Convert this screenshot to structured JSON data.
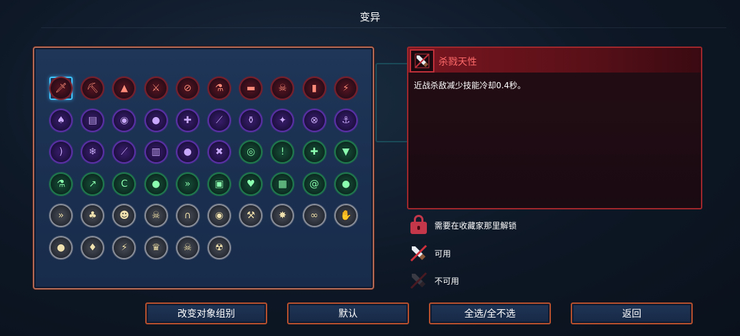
{
  "header": {
    "title": "变异"
  },
  "grid": {
    "icons": [
      {
        "icon": "sword-icon",
        "glyph": "🗡",
        "color": "red",
        "selected": true
      },
      {
        "icon": "pickaxe-icon",
        "glyph": "⛏",
        "color": "red"
      },
      {
        "icon": "spear-icon",
        "glyph": "▲",
        "color": "red"
      },
      {
        "icon": "ice-sword-icon",
        "glyph": "⚔",
        "color": "red"
      },
      {
        "icon": "no-entry-icon",
        "glyph": "⊘",
        "color": "red"
      },
      {
        "icon": "potion-icon",
        "glyph": "⚗",
        "color": "red"
      },
      {
        "icon": "chest-icon",
        "glyph": "▬",
        "color": "red"
      },
      {
        "icon": "skull-cross-icon",
        "glyph": "☠",
        "color": "red"
      },
      {
        "icon": "blue-vial-icon",
        "glyph": "▮",
        "color": "red"
      },
      {
        "icon": "lightning-fist-icon",
        "glyph": "⚡",
        "color": "red"
      },
      {
        "icon": "hat-icon",
        "glyph": "♠",
        "color": "purple"
      },
      {
        "icon": "book-blade-icon",
        "glyph": "▤",
        "color": "purple"
      },
      {
        "icon": "eye-icon",
        "glyph": "◉",
        "color": "purple"
      },
      {
        "icon": "bomb-icon",
        "glyph": "●",
        "color": "purple"
      },
      {
        "icon": "target-icon",
        "glyph": "✚",
        "color": "purple"
      },
      {
        "icon": "knife-icon",
        "glyph": "⟋",
        "color": "purple"
      },
      {
        "icon": "green-potion-icon",
        "glyph": "⚱",
        "color": "purple"
      },
      {
        "icon": "spike-icon",
        "glyph": "✦",
        "color": "purple"
      },
      {
        "icon": "no-cross-icon",
        "glyph": "⊗",
        "color": "purple"
      },
      {
        "icon": "hook-icon",
        "glyph": "⚓",
        "color": "purple"
      },
      {
        "icon": "bow-icon",
        "glyph": ")",
        "color": "purple"
      },
      {
        "icon": "frost-gun-icon",
        "glyph": "❄",
        "color": "purple"
      },
      {
        "icon": "staff-icon",
        "glyph": "⟋",
        "color": "purple"
      },
      {
        "icon": "tome-icon",
        "glyph": "▥",
        "color": "purple"
      },
      {
        "icon": "drop-icon",
        "glyph": "●",
        "color": "purple"
      },
      {
        "icon": "crossed-skull-icon",
        "glyph": "✖",
        "color": "purple"
      },
      {
        "icon": "gear-eye-icon",
        "glyph": "◎",
        "color": "green"
      },
      {
        "icon": "exclaim-shield-icon",
        "glyph": "!",
        "color": "green"
      },
      {
        "icon": "plus-shield-icon",
        "glyph": "✚",
        "color": "green"
      },
      {
        "icon": "fangs-icon",
        "glyph": "▼",
        "color": "green"
      },
      {
        "icon": "red-potion-icon",
        "glyph": "⚗",
        "color": "green"
      },
      {
        "icon": "arrow-icon",
        "glyph": "↗",
        "color": "green"
      },
      {
        "icon": "hook-claw-icon",
        "glyph": "C",
        "color": "green"
      },
      {
        "icon": "blood-drop-icon",
        "glyph": "●",
        "color": "green"
      },
      {
        "icon": "chevrons-icon",
        "glyph": "»",
        "color": "green"
      },
      {
        "icon": "knight-icon",
        "glyph": "▣",
        "color": "green"
      },
      {
        "icon": "heart-arm-icon",
        "glyph": "♥",
        "color": "green"
      },
      {
        "icon": "cage-icon",
        "glyph": "▦",
        "color": "green"
      },
      {
        "icon": "coil-icon",
        "glyph": "@",
        "color": "green"
      },
      {
        "icon": "apple-icon",
        "glyph": "●",
        "color": "green"
      },
      {
        "icon": "double-chevron-icon",
        "glyph": "»",
        "color": "grey"
      },
      {
        "icon": "leaf-blade-icon",
        "glyph": "♣",
        "color": "grey"
      },
      {
        "icon": "green-skull-icon",
        "glyph": "☻",
        "color": "grey"
      },
      {
        "icon": "white-skull-icon",
        "glyph": "☠",
        "color": "grey"
      },
      {
        "icon": "gate-icon",
        "glyph": "∩",
        "color": "grey"
      },
      {
        "icon": "purple-orb-icon",
        "glyph": "◉",
        "color": "grey"
      },
      {
        "icon": "axe-icon",
        "glyph": "⚒",
        "color": "grey"
      },
      {
        "icon": "star-burst-icon",
        "glyph": "✸",
        "color": "grey"
      },
      {
        "icon": "chain-icon",
        "glyph": "∞",
        "color": "grey"
      },
      {
        "icon": "gold-hand-icon",
        "glyph": "✋",
        "color": "grey"
      },
      {
        "icon": "gold-coin-icon",
        "glyph": "●",
        "color": "grey"
      },
      {
        "icon": "flame-drop-icon",
        "glyph": "♦",
        "color": "grey"
      },
      {
        "icon": "lightning-icon",
        "glyph": "⚡",
        "color": "grey"
      },
      {
        "icon": "purple-crown-icon",
        "glyph": "♛",
        "color": "grey"
      },
      {
        "icon": "halo-skull-icon",
        "glyph": "☠",
        "color": "grey"
      },
      {
        "icon": "flame-skull-icon",
        "glyph": "☢",
        "color": "grey"
      }
    ]
  },
  "detail": {
    "name": "杀戮天性",
    "description": "近战杀敌减少技能冷却0.4秒。",
    "icon": "sword-icon"
  },
  "legend": {
    "locked": "需要在收藏家那里解锁",
    "available": "可用",
    "unavailable": "不可用"
  },
  "buttons": {
    "change_group": "改变对象组别",
    "default": "默认",
    "select_all": "全选/全不选",
    "back": "返回"
  },
  "colors": {
    "accent_border": "#b8502e",
    "detail_border": "#a0282c",
    "selected_highlight": "#3fc6ff"
  }
}
